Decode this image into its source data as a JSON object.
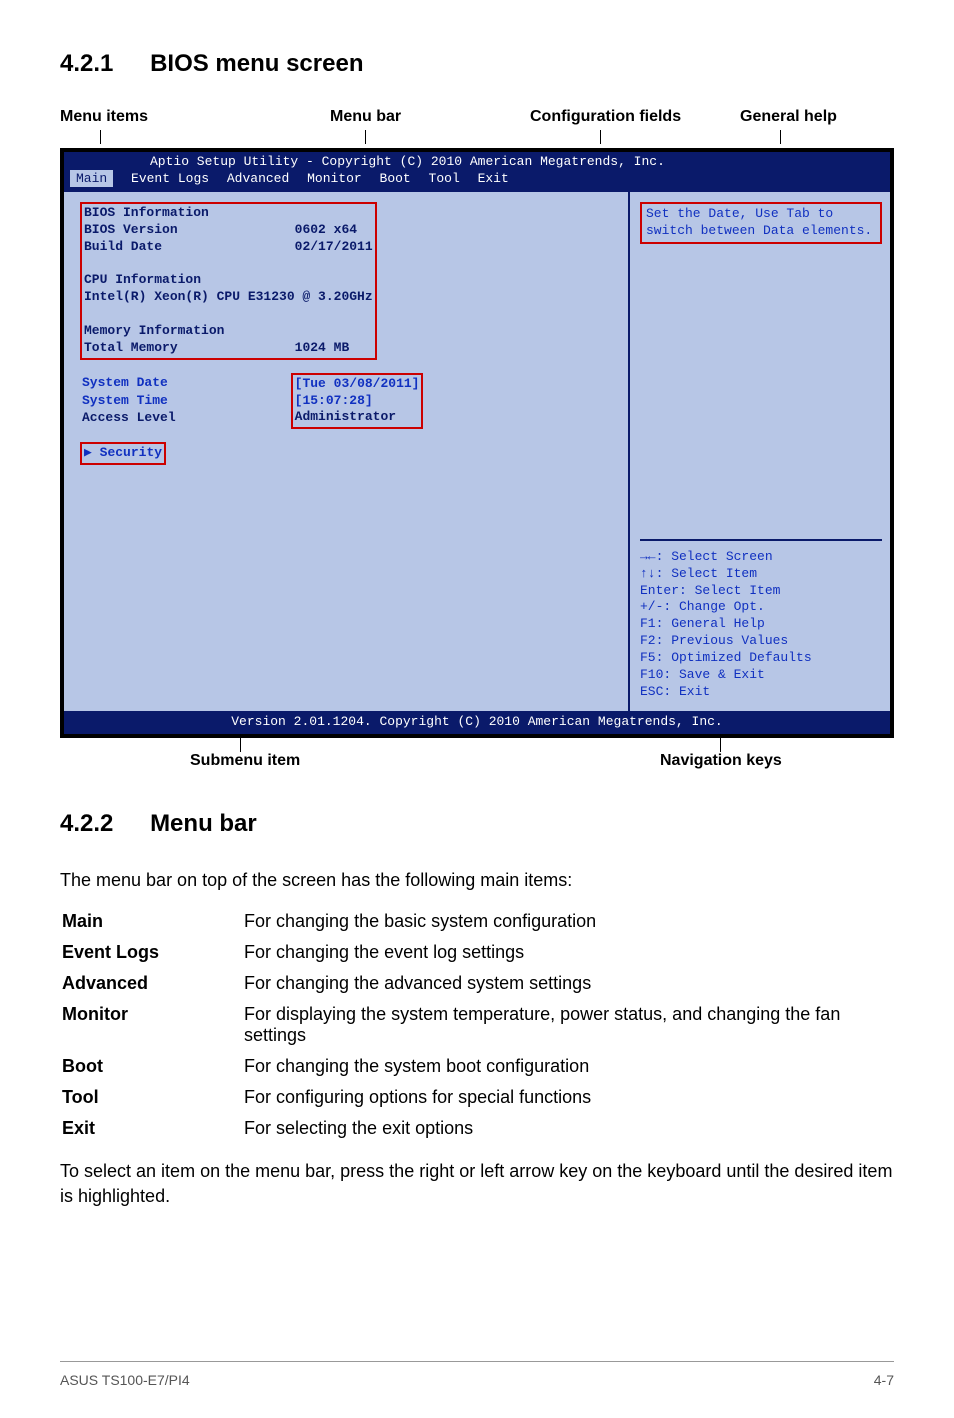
{
  "headings": {
    "h421_num": "4.2.1",
    "h421_title": "BIOS menu screen",
    "h422_num": "4.2.2",
    "h422_title": "Menu bar"
  },
  "labels": {
    "menu_items": "Menu items",
    "menu_bar": "Menu bar",
    "config_fields": "Configuration fields",
    "general_help": "General help",
    "submenu_item": "Submenu item",
    "navigation_keys": "Navigation keys"
  },
  "bios": {
    "top_line": "Aptio Setup Utility - Copyright (C) 2010 American Megatrends, Inc.",
    "menus": {
      "main": "Main",
      "event_logs": "Event Logs",
      "advanced": "Advanced",
      "monitor": "Monitor",
      "boot": "Boot",
      "tool": "Tool",
      "exit": "Exit"
    },
    "left": {
      "bios_info_hdr": "BIOS Information",
      "bios_version_label": "BIOS Version",
      "bios_version_value": "0602 x64",
      "build_date_label": "Build Date",
      "build_date_value": "02/17/2011",
      "cpu_info_hdr": "CPU Information",
      "cpu_line": "Intel(R) Xeon(R) CPU E31230 @ 3.20GHz",
      "mem_info_hdr": "Memory Information",
      "total_mem_label": "Total Memory",
      "total_mem_value": "1024 MB",
      "sys_date_label": "System Date",
      "sys_date_value": "[Tue 03/08/2011]",
      "sys_time_label": "System Time",
      "sys_time_value": "[15:07:28]",
      "access_label": "Access Level",
      "access_value": "Administrator",
      "security": "Security"
    },
    "help": {
      "line1": "Set the Date, Use Tab to",
      "line2": "switch between Data elements."
    },
    "nav": {
      "l1": "→←: Select Screen",
      "l2": "↑↓:  Select Item",
      "l3": "Enter: Select Item",
      "l4": "+/-: Change Opt.",
      "l5": "F1: General Help",
      "l6": "F2: Previous Values",
      "l7": "F5: Optimized Defaults",
      "l8": "F10: Save & Exit",
      "l9": "ESC: Exit"
    },
    "footer": "Version 2.01.1204. Copyright (C) 2010 American Megatrends, Inc."
  },
  "menubar_section": {
    "intro": "The menu bar on top of the screen has the following main items:",
    "items": [
      {
        "name": "Main",
        "desc": "For changing the basic system configuration"
      },
      {
        "name": "Event Logs",
        "desc": "For changing the event log settings"
      },
      {
        "name": "Advanced",
        "desc": "For changing the advanced system settings"
      },
      {
        "name": "Monitor",
        "desc": "For displaying the system temperature, power status, and changing the fan settings"
      },
      {
        "name": "Boot",
        "desc": "For changing the system boot configuration"
      },
      {
        "name": "Tool",
        "desc": "For configuring options for special functions"
      },
      {
        "name": "Exit",
        "desc": "For selecting the exit options"
      }
    ],
    "outro": "To select an item on the menu bar, press the right or left arrow key on the keyboard until the desired item is highlighted."
  },
  "page_footer": {
    "left": "ASUS TS100-E7/PI4",
    "right": "4-7"
  }
}
